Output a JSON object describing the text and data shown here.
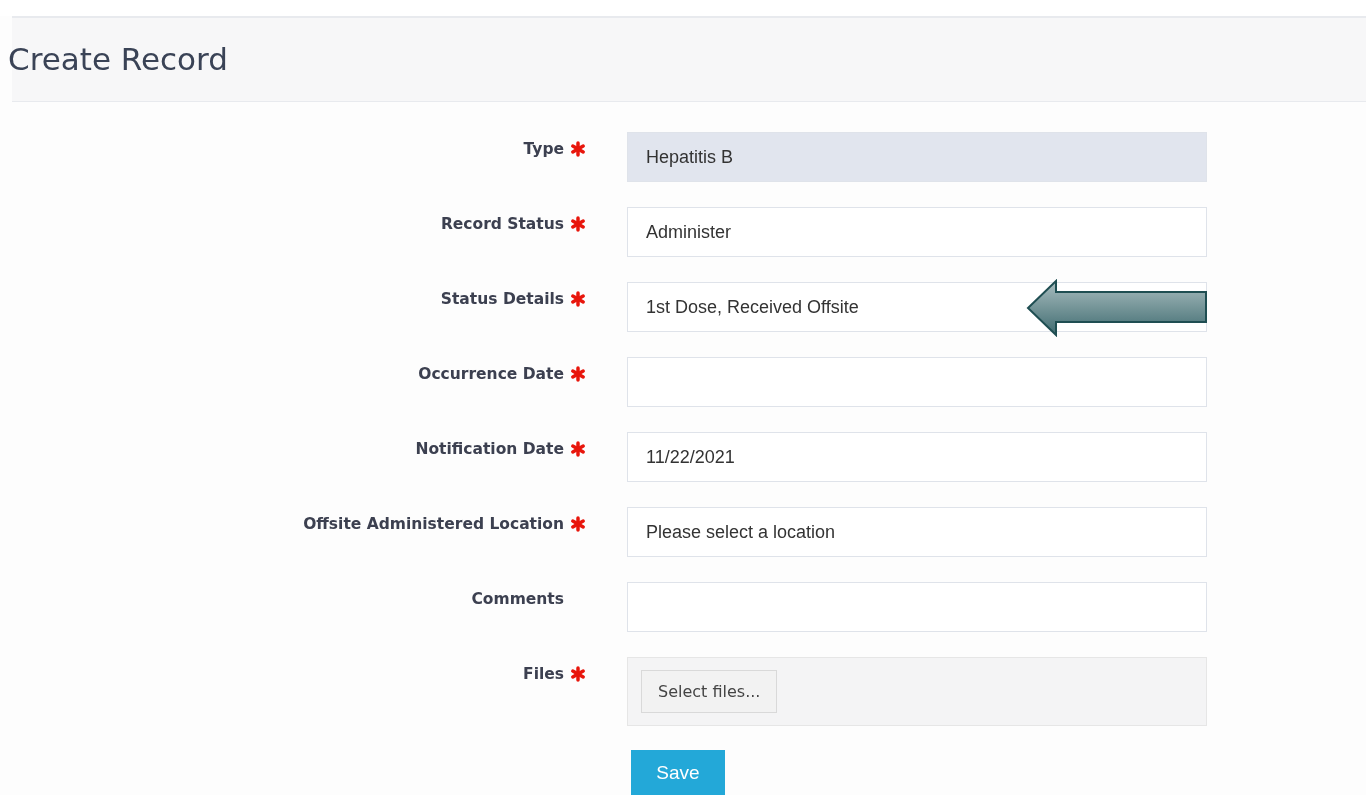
{
  "page_title": "Create Record",
  "fields": [
    {
      "kind": "text",
      "label": "Type",
      "required": true,
      "value": "Hepatitis B",
      "disabled": true,
      "callout": false
    },
    {
      "kind": "text",
      "label": "Record Status",
      "required": true,
      "value": "Administer",
      "disabled": false,
      "callout": false
    },
    {
      "kind": "text",
      "label": "Status Details",
      "required": true,
      "value": "1st Dose, Received Offsite",
      "disabled": false,
      "callout": true
    },
    {
      "kind": "text",
      "label": "Occurrence Date",
      "required": true,
      "disabled": false,
      "callout": false
    },
    {
      "kind": "text",
      "label": "Notification Date",
      "required": true,
      "value": "11/22/2021",
      "disabled": false,
      "callout": false
    },
    {
      "kind": "text",
      "label": "Offsite Administered Location",
      "required": true,
      "value": "Please select a location",
      "disabled": false,
      "callout": false
    },
    {
      "kind": "text",
      "label": "Comments",
      "required": false,
      "disabled": false,
      "callout": false
    },
    {
      "kind": "file",
      "label": "Files",
      "required": true,
      "button": "Select files..."
    }
  ],
  "save_button": "Save"
}
